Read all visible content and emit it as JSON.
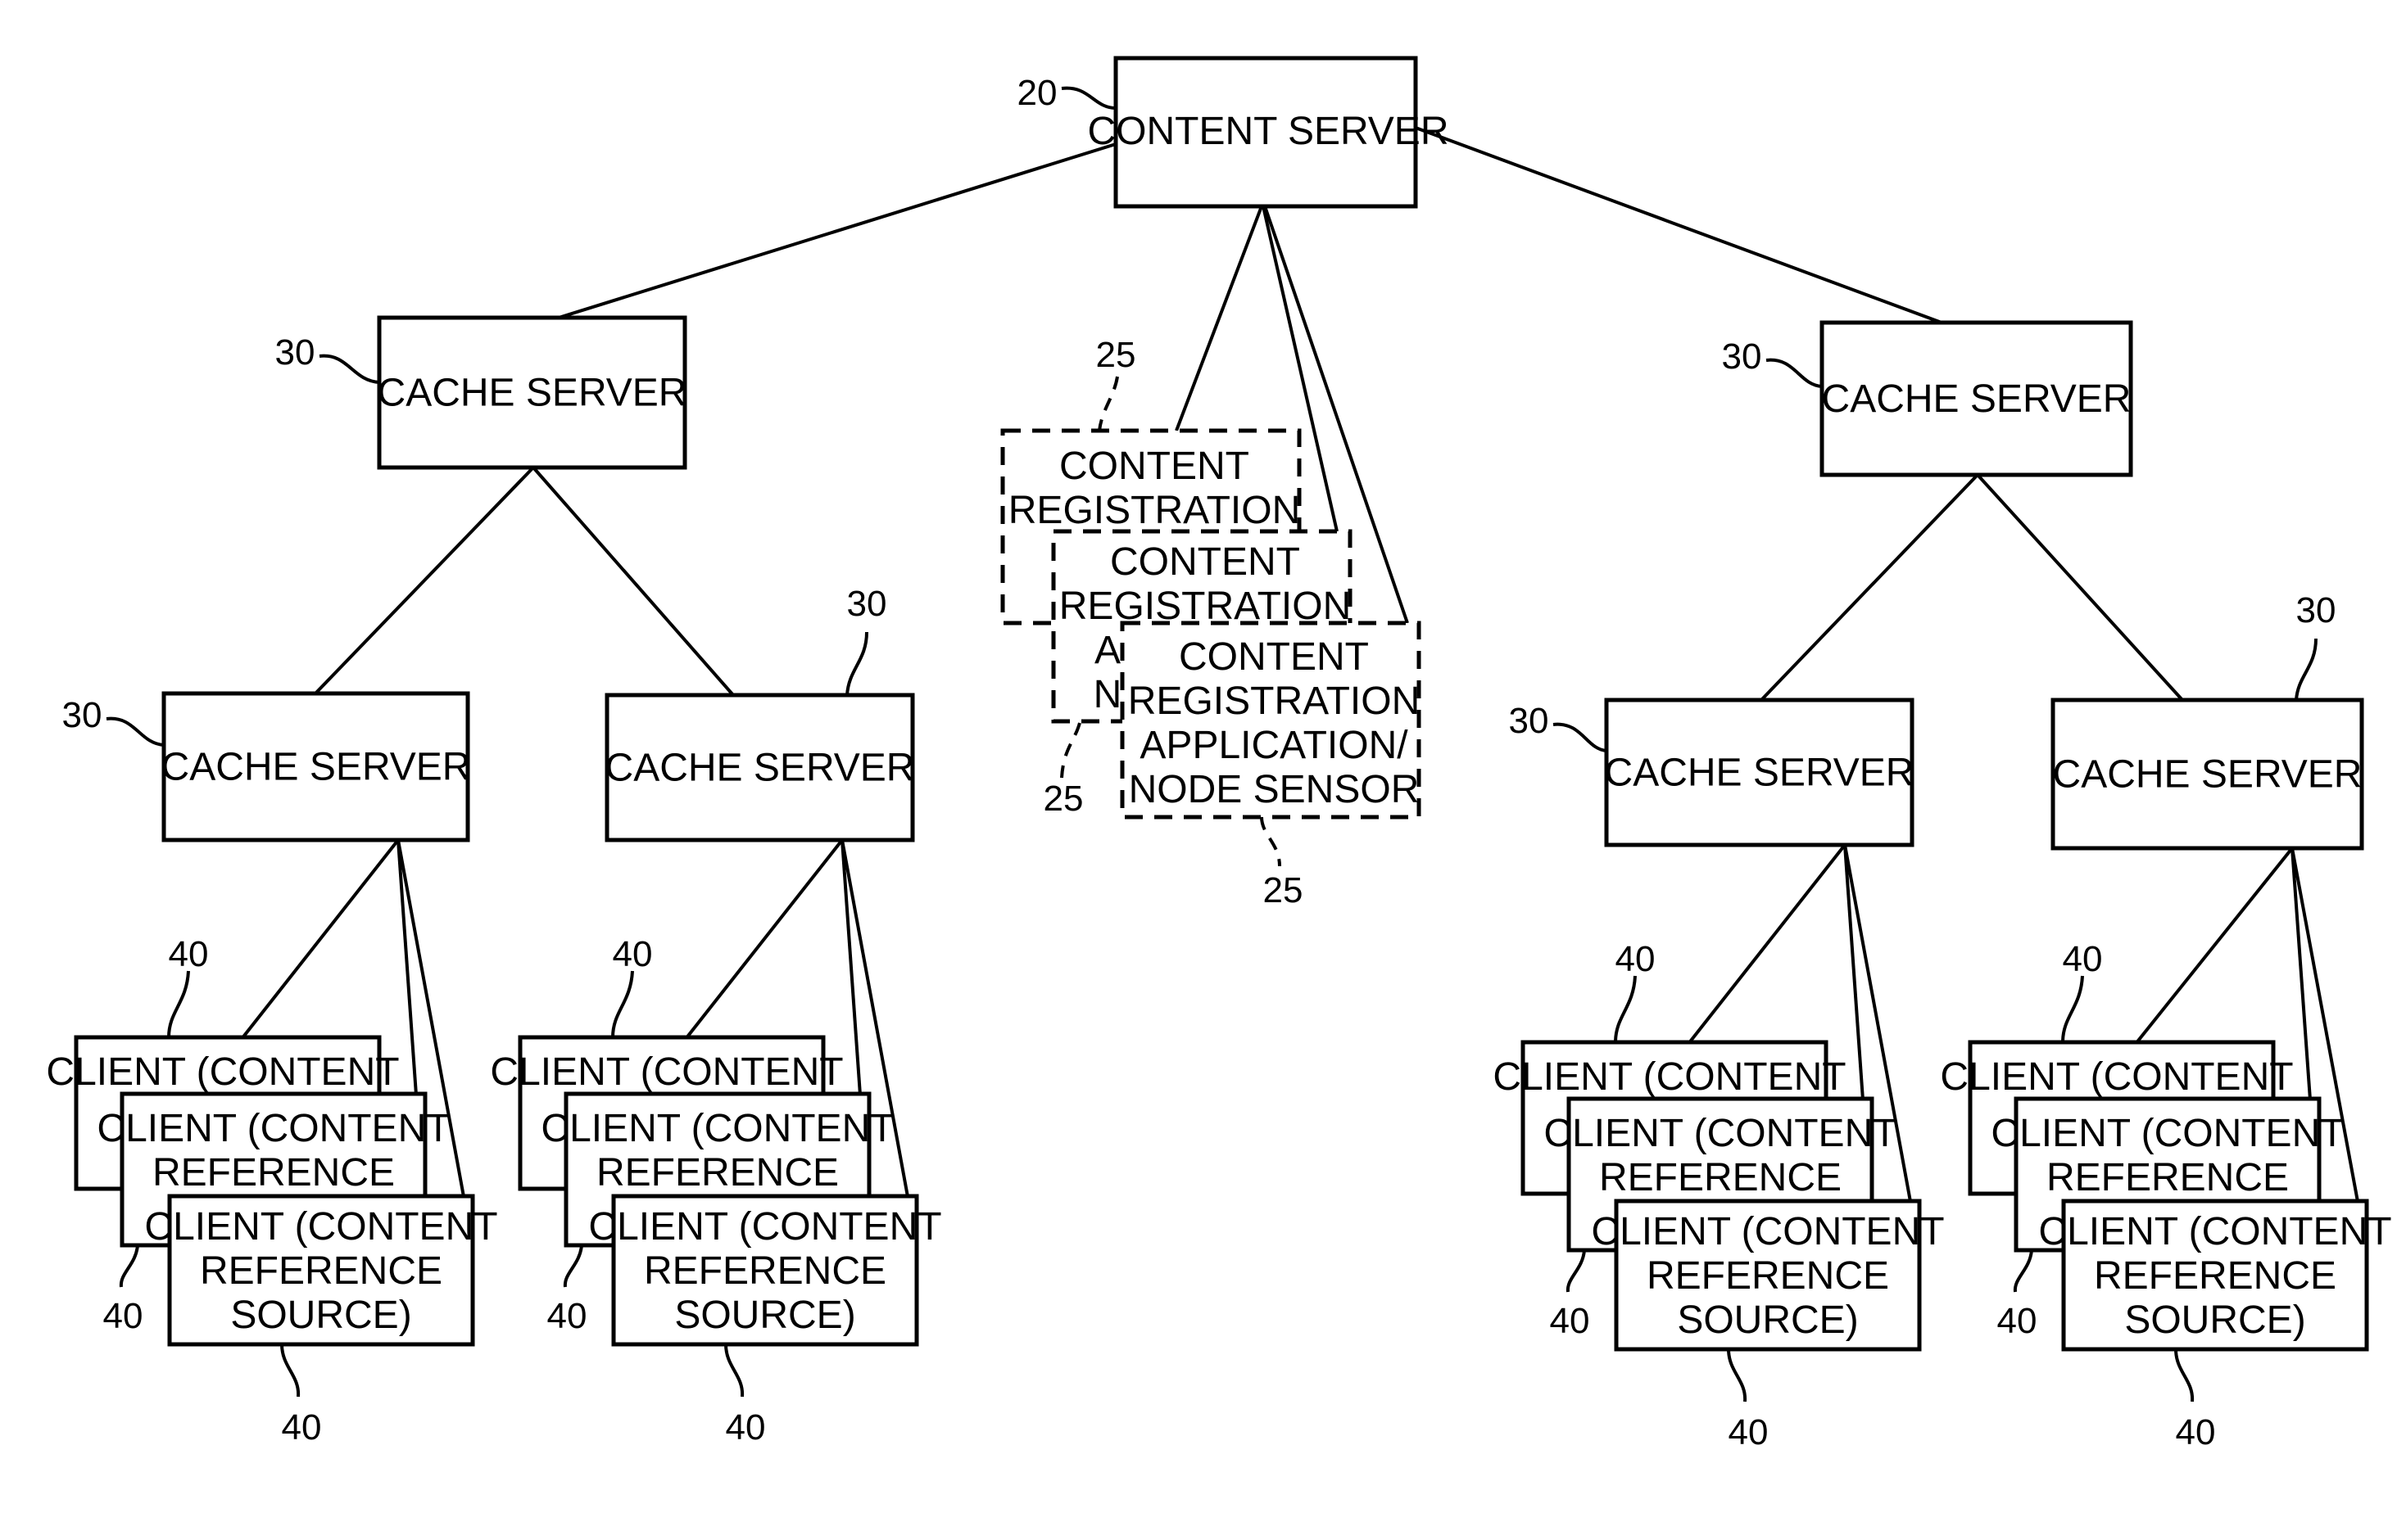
{
  "figure": {
    "content_server": {
      "label": "CONTENT SERVER",
      "ref": "20"
    },
    "cache_server_label": "CACHE SERVER",
    "cache_ref": "30",
    "registration": {
      "ref": "25",
      "boxes": [
        {
          "lines": [
            "CONTENT",
            "REGISTRATION"
          ]
        },
        {
          "lines": [
            "CONTENT",
            "REGISTRATION",
            "A",
            "N"
          ]
        },
        {
          "lines": [
            "CONTENT",
            "REGISTRATION",
            "APPLICATION/",
            "NODE SENSOR"
          ]
        }
      ]
    },
    "client_ref": "40",
    "client_boxes": [
      {
        "lines": [
          "CLIENT (CONTENT"
        ]
      },
      {
        "lines": [
          "CLIENT (CONTENT",
          "REFERENCE"
        ]
      },
      {
        "lines": [
          "CLIENT (CONTENT",
          "REFERENCE",
          "SOURCE)"
        ]
      }
    ]
  }
}
